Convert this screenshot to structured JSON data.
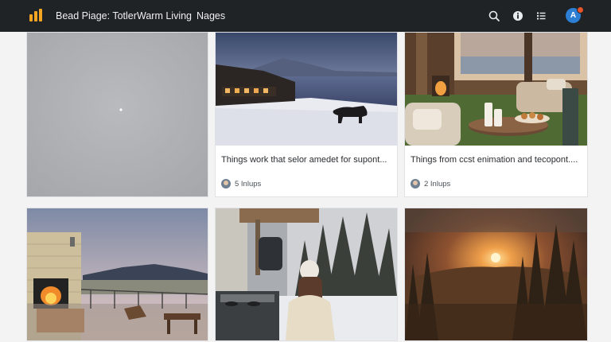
{
  "header": {
    "nav": [
      "Bead Piage: Totler",
      "Warm Living",
      "Nages"
    ],
    "icons": [
      "search-icon",
      "info-icon",
      "list-icon"
    ],
    "avatar_initial": "A",
    "brand_color": "#f4a623",
    "accent_color": "#2d7fd3"
  },
  "cards": [
    {
      "caption": "Things work that selor amedet for supont...",
      "count": "5 Inlups"
    },
    {
      "caption": "Things from ccst enimation and tecopont....",
      "count": "2 Inlups"
    }
  ]
}
